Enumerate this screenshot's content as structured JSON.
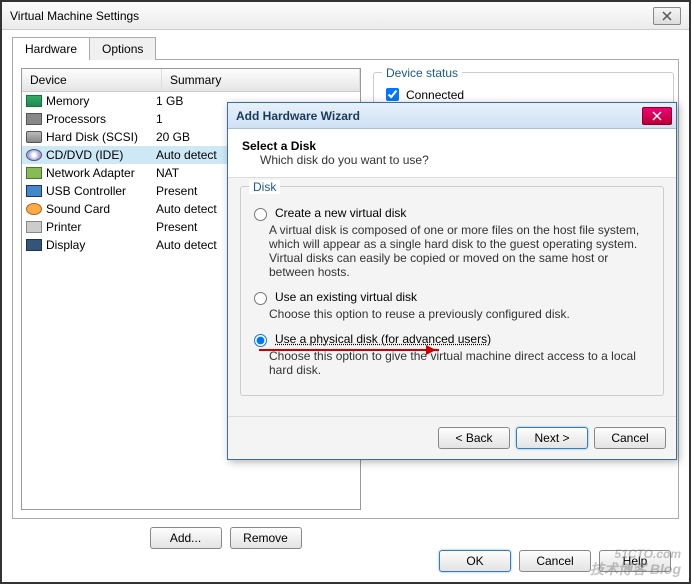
{
  "window": {
    "title": "Virtual Machine Settings"
  },
  "tabs": {
    "hardware": "Hardware",
    "options": "Options"
  },
  "table": {
    "col_device": "Device",
    "col_summary": "Summary",
    "rows": [
      {
        "name": "Memory",
        "summary": "1 GB",
        "icon": "icon-mem"
      },
      {
        "name": "Processors",
        "summary": "1",
        "icon": "icon-cpu"
      },
      {
        "name": "Hard Disk (SCSI)",
        "summary": "20 GB",
        "icon": "icon-hdd"
      },
      {
        "name": "CD/DVD (IDE)",
        "summary": "Auto detect",
        "icon": "icon-cd",
        "selected": true
      },
      {
        "name": "Network Adapter",
        "summary": "NAT",
        "icon": "icon-net"
      },
      {
        "name": "USB Controller",
        "summary": "Present",
        "icon": "icon-usb"
      },
      {
        "name": "Sound Card",
        "summary": "Auto detect",
        "icon": "icon-snd"
      },
      {
        "name": "Printer",
        "summary": "Present",
        "icon": "icon-prn"
      },
      {
        "name": "Display",
        "summary": "Auto detect",
        "icon": "icon-dsp"
      }
    ]
  },
  "status": {
    "legend": "Device status",
    "connected": "Connected"
  },
  "buttons": {
    "add": "Add...",
    "remove": "Remove",
    "ok": "OK",
    "cancel": "Cancel",
    "help": "Help"
  },
  "wizard": {
    "title": "Add Hardware Wizard",
    "heading": "Select a Disk",
    "subheading": "Which disk do you want to use?",
    "group": "Disk",
    "opt1": {
      "label": "Create a new virtual disk",
      "desc": "A virtual disk is composed of one or more files on the host file system, which will appear as a single hard disk to the guest operating system. Virtual disks can easily be copied or moved on the same host or between hosts."
    },
    "opt2": {
      "label": "Use an existing virtual disk",
      "desc": "Choose this option to reuse a previously configured disk."
    },
    "opt3": {
      "label": "Use a physical disk (for advanced users)",
      "desc": "Choose this option to give the virtual machine direct access to a local hard disk."
    },
    "back": "< Back",
    "next": "Next >",
    "cancel": "Cancel"
  },
  "watermark": {
    "main": "51CTO.com",
    "sub": "技术博客 Blog"
  }
}
